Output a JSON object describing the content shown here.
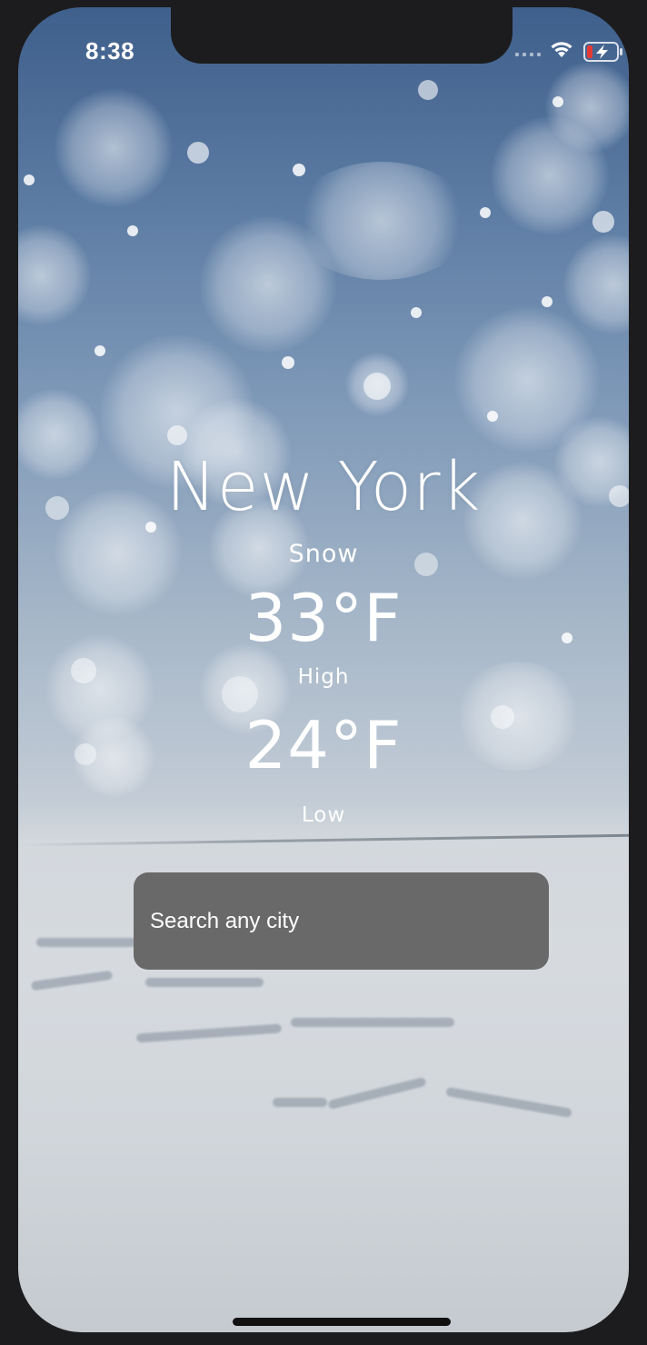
{
  "status_bar": {
    "time": "8:38",
    "icons": [
      "cellular-signal-icon",
      "wifi-icon",
      "battery-charging-icon"
    ],
    "battery_color": "#e53935"
  },
  "weather": {
    "city": "New York",
    "condition": "Snow",
    "high_temp": "33°F",
    "high_label": "High",
    "low_temp": "24°F",
    "low_label": "Low"
  },
  "search": {
    "placeholder": "Search any city",
    "value": ""
  },
  "colors": {
    "text": "#ffffff",
    "search_background": "#696969",
    "sky_top": "#3f5f8c",
    "snow_ground": "#d6dadf"
  }
}
